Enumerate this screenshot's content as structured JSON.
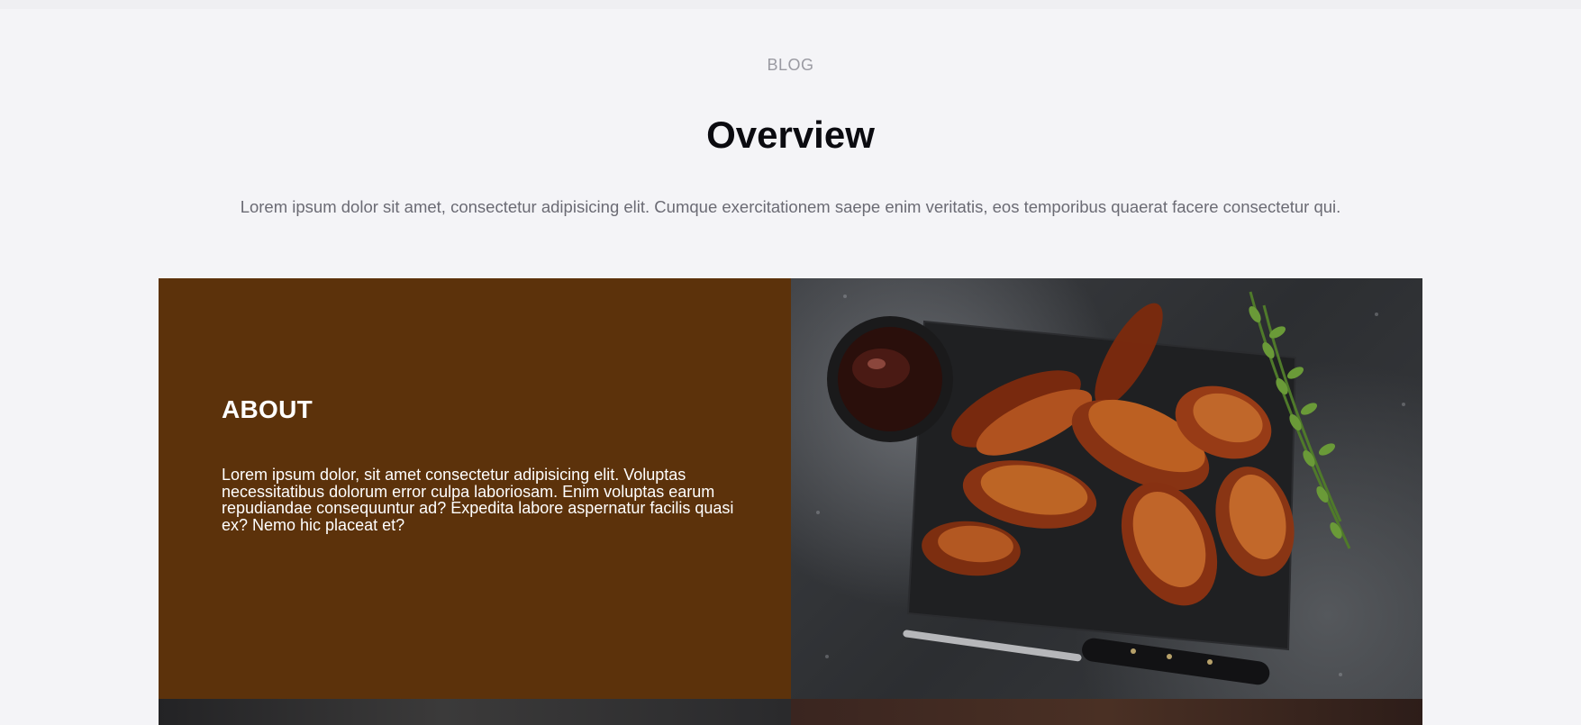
{
  "section": {
    "eyebrow": "BLOG",
    "title": "Overview",
    "lead": "Lorem ipsum dolor sit amet, consectetur adipisicing elit. Cumque exercitationem saepe enim veritatis, eos temporibus quaerat facere consectetur qui."
  },
  "about": {
    "title": "ABOUT",
    "text": "Lorem ipsum dolor, sit amet consectetur adipisicing elit. Voluptas necessitatibus dolorum error culpa laboriosam. Enim voluptas earum repudiandae consequuntur ad? Expedita labore aspernatur facilis quasi ex? Nemo hic placeat et?"
  },
  "colors": {
    "page_background": "#f4f4f7",
    "about_background": "#5c320b",
    "title": "#0b0b10",
    "muted_text": "#6b6b74"
  },
  "images": {
    "main": "bbq-chicken-wings-image",
    "row2_left": "dark-food-image",
    "row2_right": "dark-food-image-2"
  }
}
